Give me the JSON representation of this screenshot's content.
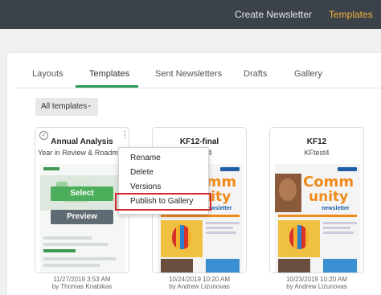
{
  "topnav": {
    "create": "Create Newsletter",
    "templates": "Templates"
  },
  "tabs": [
    {
      "label": "Layouts"
    },
    {
      "label": "Templates"
    },
    {
      "label": "Sent Newsletters"
    },
    {
      "label": "Drafts"
    },
    {
      "label": "Gallery"
    }
  ],
  "active_tab": "Templates",
  "filter": {
    "label": "All templates"
  },
  "cards": [
    {
      "title": "Annual Analysis",
      "subtitle": "Year in Review & Roadmap",
      "date": "11/27/2019 3:53 AM",
      "author": "by Thomas Knabikas",
      "select": "Select",
      "preview": "Preview"
    },
    {
      "title": "KF12-final",
      "subtitle": "KFtest4",
      "date": "10/24/2019 10:20 AM",
      "author": "by Andrew Lizunovas",
      "word1": "Comm",
      "word2": "unity",
      "word3": "newsletter"
    },
    {
      "title": "KF12",
      "subtitle": "KFtest4",
      "date": "10/23/2019 10:20 AM",
      "author": "by Andrew Lizunovas",
      "word1": "Comm",
      "word2": "unity",
      "word3": "newsletter"
    }
  ],
  "context_menu": [
    "Rename",
    "Delete",
    "Versions",
    "Publish to Gallery"
  ],
  "colors": {
    "topbar": "#3b424a",
    "accent": "#f2b33d",
    "green": "#2f9a5b",
    "highlight": "#d22a2a"
  }
}
